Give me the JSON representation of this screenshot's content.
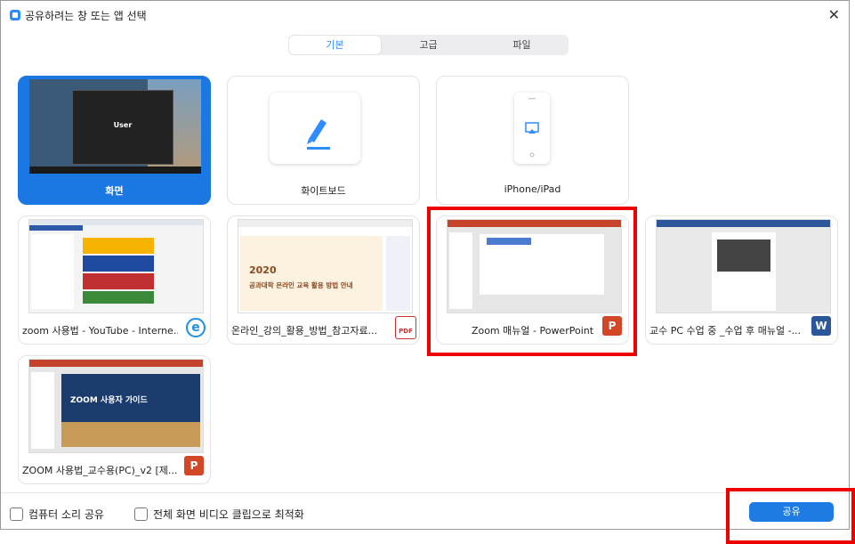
{
  "window": {
    "title": "공유하려는 창 또는 앱 선택",
    "close_glyph": "✕"
  },
  "tabs": [
    {
      "label": "기본",
      "active": true
    },
    {
      "label": "고급",
      "active": false
    },
    {
      "label": "파일",
      "active": false
    }
  ],
  "sources": {
    "screen": {
      "label": "화면",
      "user_label": "User"
    },
    "whiteboard": {
      "label": "화이트보드",
      "icon": "pen-icon"
    },
    "iphone": {
      "label": "iPhone/iPad",
      "icon": "airplay-icon"
    },
    "windows": [
      {
        "label": "zoom 사용법 - YouTube - Interne...",
        "icon": "internet-explorer-icon"
      },
      {
        "label": "온라인_강의_활용_방법_참고자료...",
        "icon": "pdf-icon",
        "thumb_title": "2020",
        "thumb_subtitle": "공과대학 온라인 교육 활용 방법 안내"
      },
      {
        "label": "Zoom 매뉴얼 - PowerPoint",
        "icon": "powerpoint-icon",
        "badge": "P"
      },
      {
        "label": "교수 PC 수업 중 _수업 후 매뉴얼 -...",
        "icon": "word-icon",
        "badge": "W"
      },
      {
        "label": "ZOOM 사용법_교수용(PC)_v2 [제...",
        "icon": "powerpoint-icon",
        "badge": "P",
        "thumb_title": "ZOOM 사용자 가이드"
      }
    ]
  },
  "footer": {
    "share_audio": "컴퓨터 소리 공유",
    "optimize_video": "전체 화면 비디오 클립으로 최적화",
    "share_button": "공유"
  },
  "badges": {
    "pdf_text": "PDF"
  },
  "colors": {
    "accent": "#2d8cff",
    "highlight": "#e00000",
    "selected_card": "#1b78e2"
  }
}
